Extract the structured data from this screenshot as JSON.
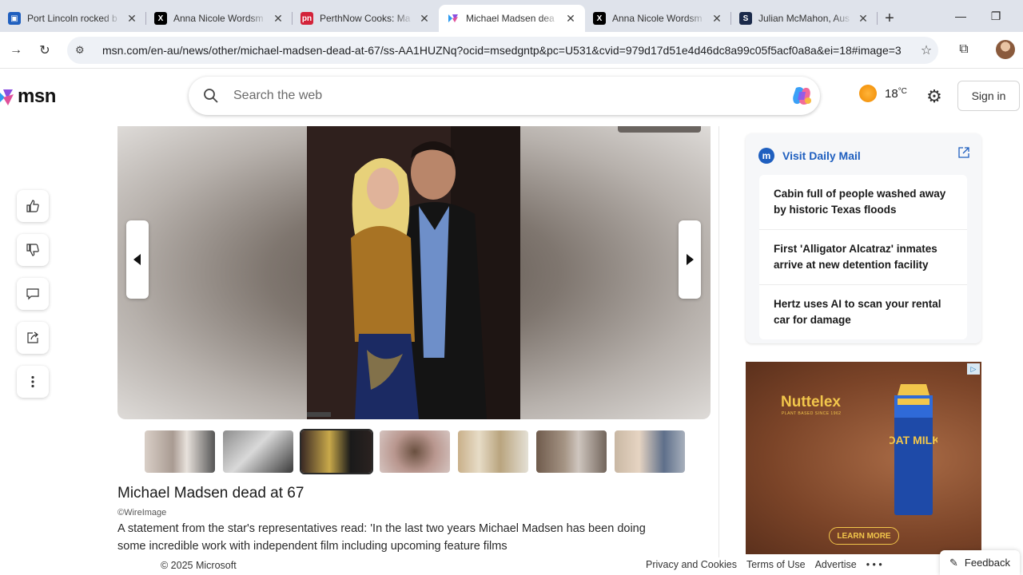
{
  "browser": {
    "tabs": [
      {
        "title": "Port Lincoln rocked b",
        "favicon": "msn-news-icon",
        "color": "#1f5fbf",
        "active": false
      },
      {
        "title": "Anna Nicole Wordsm",
        "favicon": "x-icon",
        "color": "#000000",
        "active": false
      },
      {
        "title": "PerthNow Cooks: Ma",
        "favicon": "perthnow-icon",
        "color": "#d3233a",
        "active": false
      },
      {
        "title": "Michael Madsen dea",
        "favicon": "msn-icon",
        "color": "#6b4ee6",
        "active": true
      },
      {
        "title": "Anna Nicole Wordsm",
        "favicon": "x-icon",
        "color": "#000000",
        "active": false
      },
      {
        "title": "Julian McMahon, Aus",
        "favicon": "s-icon",
        "color": "#1b2a4a",
        "active": false
      }
    ],
    "url": "msn.com/en-au/news/other/michael-madsen-dead-at-67/ss-AA1HUZNq?ocid=msedgntp&pc=U531&cvid=979d17d51e4d46dc8a99c05f5acf0a8a&ei=18#image=3"
  },
  "header": {
    "logo_text": "msn",
    "search_placeholder": "Search the web",
    "temperature": "18",
    "temperature_unit": "°C",
    "signin_label": "Sign in"
  },
  "article": {
    "title": "Michael Madsen dead at 67",
    "credit": "©WireImage",
    "description": "A statement from the star's representatives read: 'In the last two years Michael Madsen has been doing some incredible work with independent film including upcoming feature films",
    "thumbnails": 7,
    "selected_thumbnail": 3
  },
  "sidebar": {
    "source_label": "Visit Daily Mail",
    "headlines": [
      "Cabin full of people washed away by historic Texas floods",
      "First 'Alligator Alcatraz' inmates arrive at new detention facility",
      "Hertz uses AI to scan your rental car for damage"
    ]
  },
  "ad": {
    "brand": "Nuttelex",
    "tagline": "PLANT BASED SINCE 1962",
    "product": "OAT MILK",
    "cta": "LEARN MORE"
  },
  "footer": {
    "copyright": "© 2025 Microsoft",
    "links": [
      "Privacy and Cookies",
      "Terms of Use",
      "Advertise"
    ],
    "more": "• • •",
    "feedback": "Feedback"
  }
}
